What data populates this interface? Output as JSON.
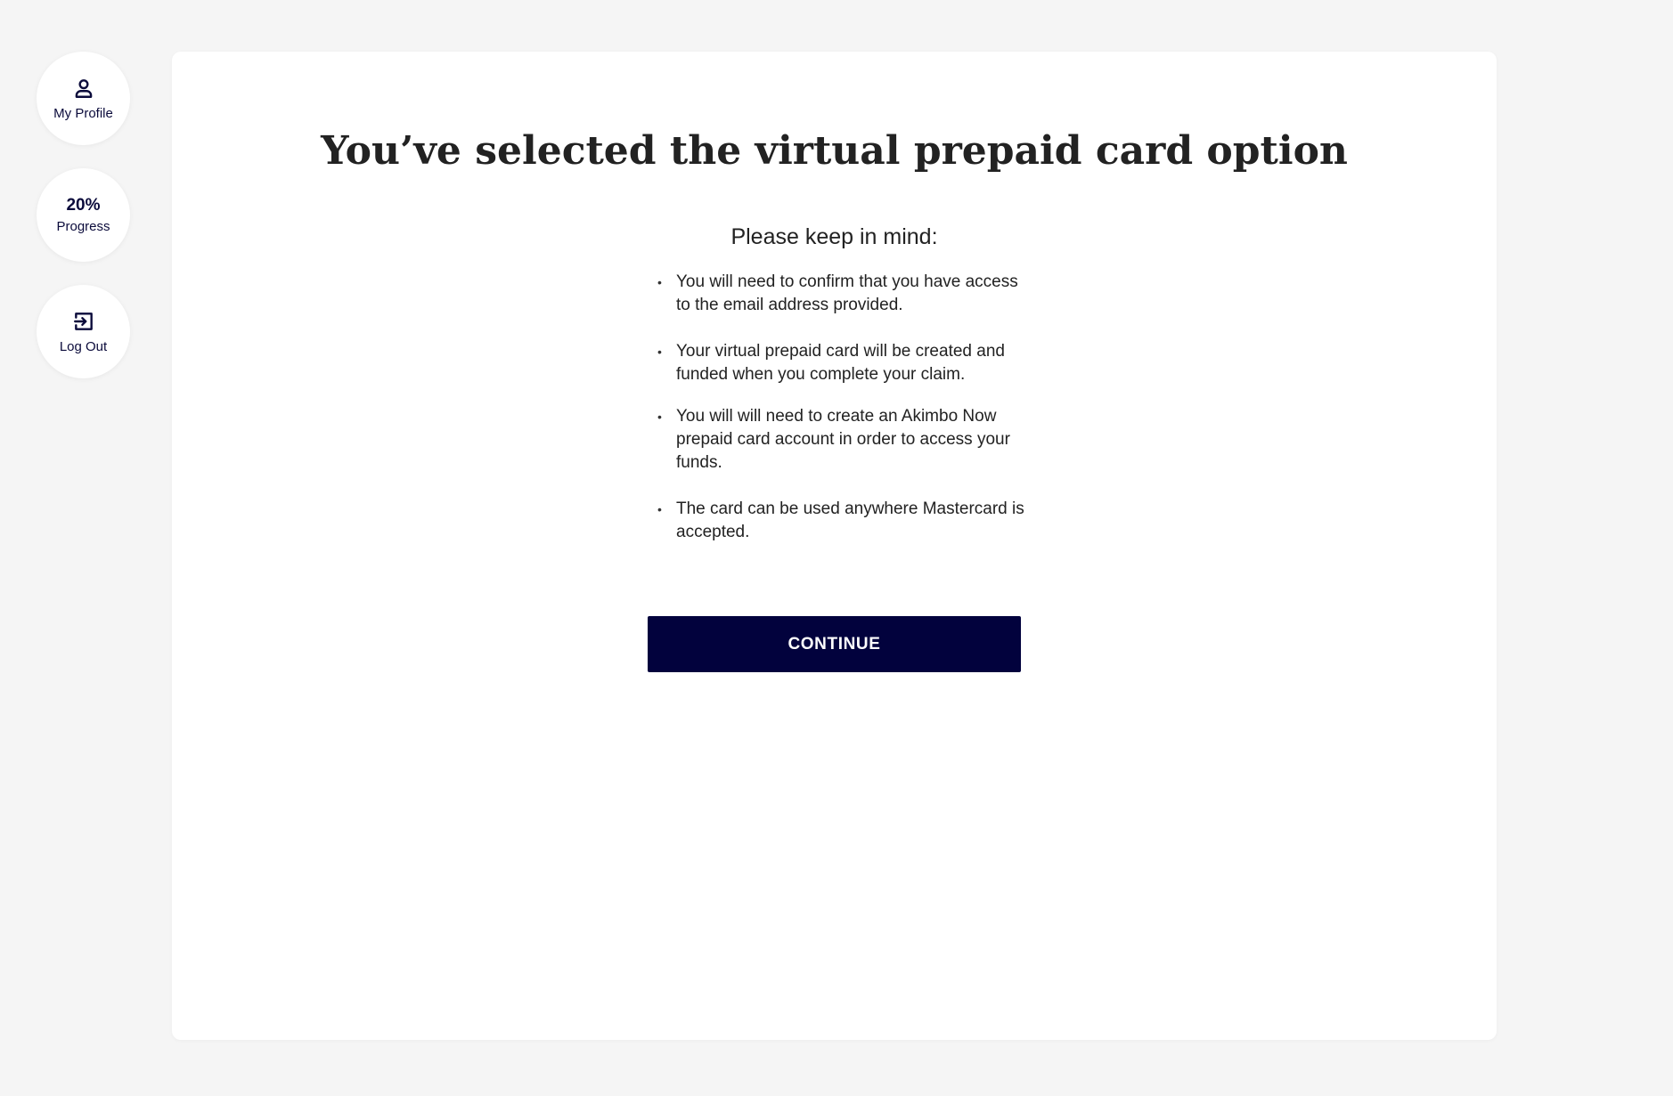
{
  "sidebar": {
    "profile": {
      "label": "My Profile",
      "icon": "user-icon"
    },
    "progress": {
      "value": "20%",
      "label": "Progress"
    },
    "logout": {
      "label": "Log Out",
      "icon": "logout-icon"
    }
  },
  "main": {
    "title": "You’ve selected the virtual prepaid card option",
    "subtitle": "Please keep in mind:",
    "bullets": [
      "You will need to confirm that you have access to the email address provided.",
      "Your virtual prepaid card will be created and funded when you complete your claim.",
      "You will will need to create an Akimbo Now prepaid card account in order to access your funds.",
      "The card can be used anywhere Mastercard is accepted."
    ],
    "continue_label": "CONTINUE"
  },
  "colors": {
    "background": "#f5f5f5",
    "card": "#ffffff",
    "primary": "#02023d",
    "text": "#222222"
  }
}
